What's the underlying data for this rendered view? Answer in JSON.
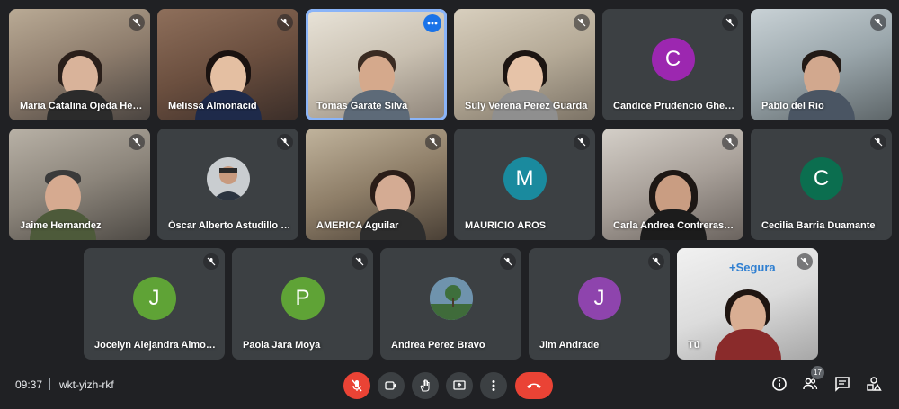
{
  "participants": [
    {
      "name": "Maria Catalina Ojeda Her...",
      "type": "video"
    },
    {
      "name": "Melissa Almonacid",
      "type": "video"
    },
    {
      "name": "Tomas Garate Silva",
      "type": "video",
      "speaking": true
    },
    {
      "name": "Suly Verena Perez Guarda",
      "type": "video"
    },
    {
      "name": "Candice Prudencio Ghellere",
      "type": "avatar",
      "initial": "C",
      "color": "#9c27b0"
    },
    {
      "name": "Pablo del Rio",
      "type": "video"
    },
    {
      "name": "Jaime Hernandez",
      "type": "video"
    },
    {
      "name": "Óscar Alberto Astudillo Br...",
      "type": "photo"
    },
    {
      "name": "AMERICA Aguilar",
      "type": "video"
    },
    {
      "name": "MAURICIO AROS",
      "type": "avatar",
      "initial": "M",
      "color": "#1a8a9e"
    },
    {
      "name": "Carla Andrea Contreras B...",
      "type": "video"
    },
    {
      "name": "Cecilia Barria Duamante",
      "type": "avatar",
      "initial": "C",
      "color": "#0b6e4f"
    },
    {
      "name": "Jocelyn Alejandra Almona...",
      "type": "avatar",
      "initial": "J",
      "color": "#5fa336"
    },
    {
      "name": "Paola Jara Moya",
      "type": "avatar",
      "initial": "P",
      "color": "#5fa336"
    },
    {
      "name": "Andrea Perez Bravo",
      "type": "photo"
    },
    {
      "name": "Jim Andrade",
      "type": "avatar",
      "initial": "J",
      "color": "#8e44ad"
    },
    {
      "name": "Tú",
      "type": "video",
      "self": true
    }
  ],
  "self_tile": {
    "banner_text": "+Segura"
  },
  "bottom_bar": {
    "time": "09:37",
    "meeting_code": "wkt-yizh-rkf",
    "participant_count": "17"
  },
  "colors": {
    "background": "#202124",
    "tile": "#3c4043",
    "danger": "#ea4335",
    "active_border": "#8ab4f8"
  }
}
